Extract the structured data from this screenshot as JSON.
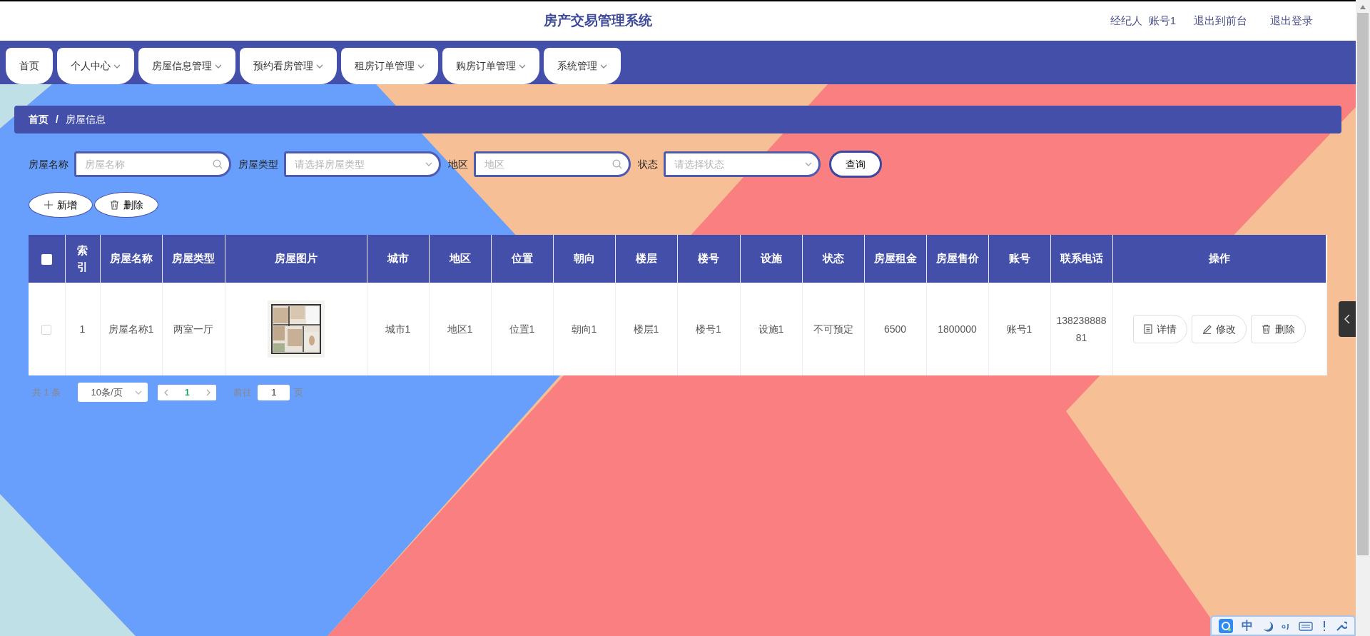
{
  "header": {
    "title": "房产交易管理系统",
    "user_role": "经纪人",
    "username": "账号1",
    "links": [
      "退出到前台",
      "退出登录"
    ]
  },
  "nav": [
    {
      "label": "首页",
      "has_dropdown": false,
      "selected": false
    },
    {
      "label": "个人中心",
      "has_dropdown": true,
      "selected": false
    },
    {
      "label": "房屋信息管理",
      "has_dropdown": true,
      "selected": false
    },
    {
      "label": "预约看房管理",
      "has_dropdown": true,
      "selected": false
    },
    {
      "label": "租房订单管理",
      "has_dropdown": true,
      "selected": false
    },
    {
      "label": "购房订单管理",
      "has_dropdown": true,
      "selected": false
    },
    {
      "label": "系统管理",
      "has_dropdown": true,
      "selected": false
    }
  ],
  "breadcrumb": {
    "items": [
      "首页",
      "房屋信息"
    ],
    "separator": "/"
  },
  "filters": [
    {
      "kind": "input",
      "label": "房屋名称",
      "placeholder": "房屋名称"
    },
    {
      "kind": "select",
      "label": "房屋类型",
      "placeholder": "请选择房屋类型"
    },
    {
      "kind": "input",
      "label": "地区",
      "placeholder": "地区"
    },
    {
      "kind": "select",
      "label": "状态",
      "placeholder": "请选择状态"
    }
  ],
  "search_button": "查询",
  "actions": [
    {
      "kind": "add",
      "label": "新增"
    },
    {
      "kind": "delete",
      "label": "删除"
    }
  ],
  "table": {
    "select_all_checked": false,
    "columns": [
      "索引",
      "房屋名称",
      "房屋类型",
      "房屋图片",
      "城市",
      "地区",
      "位置",
      "朝向",
      "楼层",
      "楼号",
      "设施",
      "状态",
      "房屋租金",
      "房屋售价",
      "账号",
      "联系电话",
      "操作"
    ],
    "rows": [
      {
        "checked": false,
        "cells": [
          "1",
          "房屋名称1",
          "两室一厅",
          {
            "kind": "picture"
          },
          "城市1",
          "地区1",
          "位置1",
          "朝向1",
          "楼层1",
          "楼号1",
          "设施1",
          "不可预定",
          "6500",
          "1800000",
          "账号1",
          "13823888881"
        ],
        "operations": [
          {
            "kind": "detail",
            "label": "详情"
          },
          {
            "kind": "edit",
            "label": "修改"
          },
          {
            "kind": "delete",
            "label": "删除"
          }
        ]
      }
    ]
  },
  "pagination": {
    "total_prefix": "共",
    "total": "1",
    "total_suffix": "条",
    "page_size": "10条/页",
    "pages": [
      {
        "label": "1",
        "selected": true
      }
    ],
    "goto_label": "前往",
    "goto_value": "1",
    "page_label": "页"
  },
  "ime": {
    "mode": "中"
  }
}
